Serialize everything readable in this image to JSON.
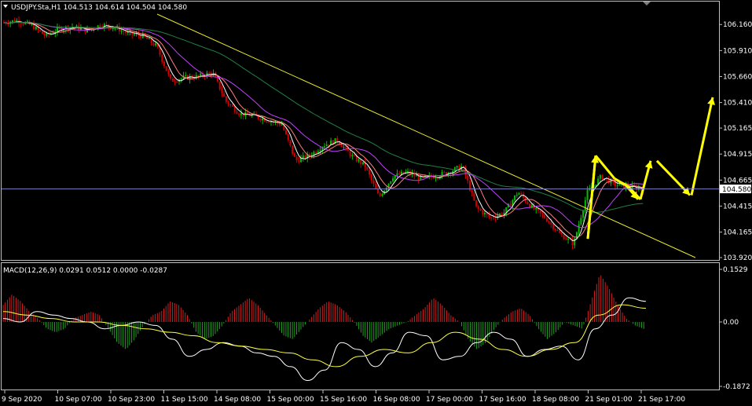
{
  "chart_data": [
    {
      "type": "candlestick",
      "title": "USDJPY.Sta,H1  104.513 104.614 104.504 104.580",
      "symbol": "USDJPY.Sta,H1",
      "ohlc_last": {
        "open": 104.513,
        "high": 104.614,
        "low": 104.504,
        "close": 104.58
      },
      "ylim": [
        103.92,
        106.26
      ],
      "y_ticks": [
        "106.160",
        "105.910",
        "105.660",
        "105.410",
        "105.165",
        "104.915",
        "104.665",
        "104.415",
        "104.165",
        "103.920"
      ],
      "current_price_label": "104.580",
      "current_price": 104.58,
      "x_ticks": [
        "9 Sep 2020",
        "10 Sep 07:00",
        "10 Sep 23:00",
        "11 Sep 15:00",
        "14 Sep 08:00",
        "15 Sep 00:00",
        "15 Sep 16:00",
        "16 Sep 08:00",
        "17 Sep 00:00",
        "17 Sep 16:00",
        "18 Sep 08:00",
        "21 Sep 01:00",
        "21 Sep 17:00"
      ],
      "price_path": [
        106.18,
        106.2,
        106.15,
        106.05,
        106.12,
        106.14,
        106.1,
        106.16,
        106.13,
        106.07,
        106.05,
        105.95,
        105.62,
        105.65,
        105.66,
        105.7,
        105.42,
        105.3,
        105.28,
        105.24,
        105.2,
        104.85,
        104.9,
        105.0,
        105.05,
        104.9,
        104.8,
        104.5,
        104.7,
        104.74,
        104.68,
        104.7,
        104.74,
        104.8,
        104.4,
        104.3,
        104.35,
        104.55,
        104.4,
        104.3,
        104.15,
        104.05,
        104.55,
        104.7,
        104.62,
        104.6,
        104.58
      ],
      "forecast_arrows": [
        [
          104.1,
          104.9,
          104.68,
          104.6,
          104.48
        ],
        [
          104.48,
          104.85,
          104.52,
          105.46
        ]
      ]
    },
    {
      "type": "histogram",
      "title": "MACD(12,26,9) 0.0291 0.0512 0.0000 -0.0287",
      "ylim": [
        -0.1872,
        0.1529
      ],
      "y_ticks": [
        "0.1529",
        "0.00",
        "-0.1872"
      ],
      "macd_hist": [
        0.05,
        0.08,
        0.06,
        0.03,
        0.01,
        -0.02,
        -0.03,
        -0.02,
        0.01,
        0.02,
        0.03,
        0.02,
        -0.02,
        -0.06,
        -0.08,
        -0.05,
        -0.01,
        0.02,
        0.03,
        0.06,
        0.05,
        0.02,
        -0.03,
        -0.05,
        -0.04,
        -0.01,
        0.03,
        0.05,
        0.07,
        0.05,
        0.02,
        -0.01,
        -0.04,
        -0.05,
        -0.02,
        0.01,
        0.04,
        0.06,
        0.05,
        0.03,
        0.0,
        -0.04,
        -0.06,
        -0.04,
        -0.02,
        -0.01,
        0.0,
        0.02,
        0.04,
        0.07,
        0.05,
        0.02,
        0.0,
        -0.05,
        -0.08,
        -0.06,
        -0.02,
        0.01,
        0.03,
        0.04,
        0.02,
        -0.02,
        -0.05,
        -0.03,
        0.0,
        -0.01,
        -0.02,
        0.06,
        0.14,
        0.1,
        0.05,
        0.01,
        -0.01,
        -0.02
      ],
      "main_line": [
        0.01,
        0.0,
        0.03,
        0.02,
        0.01,
        0.0,
        -0.02,
        -0.01,
        0.0,
        -0.01,
        -0.05,
        -0.1,
        -0.08,
        -0.06,
        -0.07,
        -0.09,
        -0.1,
        -0.13,
        -0.17,
        -0.14,
        -0.06,
        -0.08,
        -0.13,
        -0.09,
        -0.03,
        -0.04,
        -0.11,
        -0.1,
        -0.06,
        -0.03,
        -0.05,
        -0.1,
        -0.08,
        -0.07,
        -0.11,
        -0.02,
        0.02,
        0.07,
        0.06
      ],
      "signal_line": [
        0.03,
        0.02,
        0.01,
        0.0,
        0.0,
        -0.01,
        -0.02,
        -0.03,
        -0.04,
        -0.06,
        -0.07,
        -0.08,
        -0.09,
        -0.11,
        -0.13,
        -0.1,
        -0.08,
        -0.09,
        -0.06,
        -0.03,
        -0.05,
        -0.08,
        -0.1,
        -0.08,
        -0.06,
        0.02,
        0.05,
        0.04
      ]
    }
  ]
}
